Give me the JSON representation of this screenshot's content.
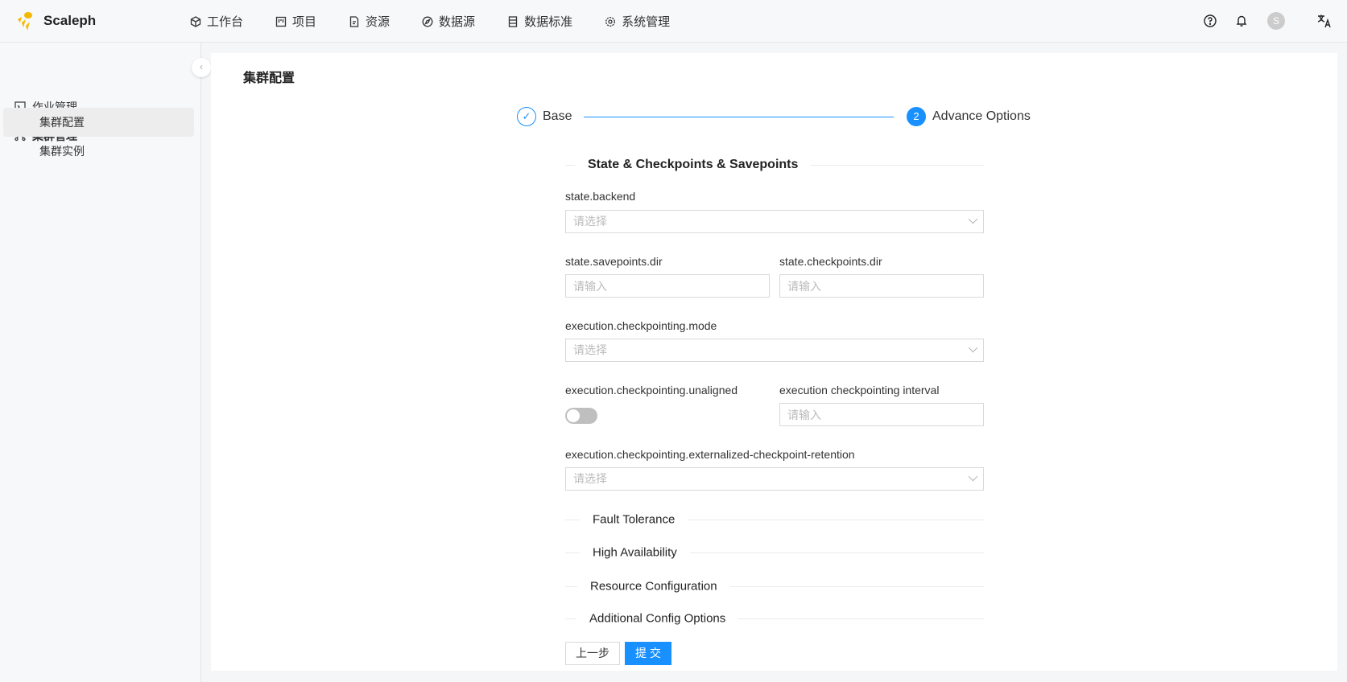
{
  "app": {
    "name": "Scaleph"
  },
  "nav": [
    {
      "label": "工作台",
      "icon": "cube-icon"
    },
    {
      "label": "项目",
      "icon": "project-icon"
    },
    {
      "label": "资源",
      "icon": "file-icon"
    },
    {
      "label": "数据源",
      "icon": "compass-icon"
    },
    {
      "label": "数据标准",
      "icon": "database-icon"
    },
    {
      "label": "系统管理",
      "icon": "gear-icon"
    }
  ],
  "header": {
    "avatar": "S"
  },
  "sidebar": {
    "groups": [
      {
        "label": "作业管理",
        "expanded": false
      },
      {
        "label": "集群管理",
        "expanded": true
      }
    ],
    "items": [
      {
        "label": "集群配置",
        "active": true
      },
      {
        "label": "集群实例",
        "active": false
      }
    ]
  },
  "page": {
    "title": "集群配置"
  },
  "steps": [
    {
      "label": "Base",
      "status": "done"
    },
    {
      "number": "2",
      "label": "Advance Options",
      "status": "current"
    }
  ],
  "form": {
    "section1": "State & Checkpoints & Savepoints",
    "state_backend": {
      "label": "state.backend",
      "placeholder": "请选择"
    },
    "savepoints_dir": {
      "label": "state.savepoints.dir",
      "placeholder": "请输入"
    },
    "checkpoints_dir": {
      "label": "state.checkpoints.dir",
      "placeholder": "请输入"
    },
    "mode": {
      "label": "execution.checkpointing.mode",
      "placeholder": "请选择"
    },
    "unaligned": {
      "label": "execution.checkpointing.unaligned",
      "value": false
    },
    "interval": {
      "label": "execution checkpointing interval",
      "placeholder": "请输入"
    },
    "retention": {
      "label": "execution.checkpointing.externalized-checkpoint-retention",
      "placeholder": "请选择"
    },
    "sections": [
      "Fault Tolerance",
      "High Availability",
      "Resource Configuration",
      "Additional Config Options"
    ]
  },
  "buttons": {
    "prev": "上一步",
    "submit": "提 交"
  },
  "colors": {
    "primary": "#1890ff"
  }
}
